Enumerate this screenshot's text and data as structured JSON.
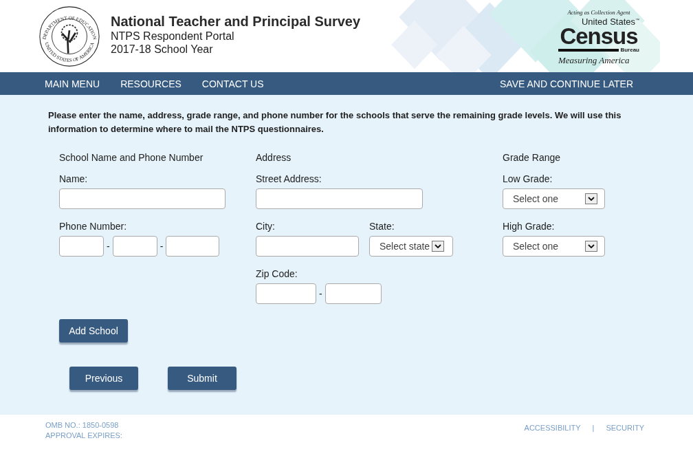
{
  "header": {
    "seal": {
      "top_text": "DEPARTMENT OF EDUCATION",
      "bottom_text": "UNITED STATES OF AMERICA"
    },
    "title": "National Teacher and Principal Survey",
    "subtitle": "NTPS Respondent Portal",
    "year": "2017-18 School Year",
    "census": {
      "tagline": "Acting as Collection Agent",
      "line1": "United States",
      "tm": "™",
      "name": "Census",
      "bureau": "Bureau",
      "motto": "Measuring America"
    }
  },
  "nav": {
    "items": [
      "MAIN MENU",
      "RESOURCES",
      "CONTACT US"
    ],
    "right": "SAVE AND CONTINUE LATER"
  },
  "instructions": "Please enter the name, address, grade range, and phone number for the schools that serve the remaining grade levels. We will use this information to determine where to mail the NTPS questionnaires.",
  "school": {
    "heading": "School Name and Phone Number",
    "name_label": "Name:",
    "phone_label": "Phone Number:",
    "phone_separators": [
      "-",
      "-"
    ]
  },
  "address": {
    "heading": "Address",
    "street_label": "Street Address:",
    "city_label": "City:",
    "state_label": "State:",
    "state_select": "Select state",
    "zip_label": "Zip Code:",
    "zip_separator": "-"
  },
  "grade": {
    "heading": "Grade Range",
    "low_label": "Low Grade:",
    "low_select": "Select one",
    "high_label": "High Grade:",
    "high_select": "Select one"
  },
  "add_button": "Add School",
  "buttons": [
    "Previous",
    "Submit"
  ],
  "footer": {
    "omb": "OMB NO.: 1850-0598",
    "expires": "APPROVAL EXPIRES:",
    "links": [
      "ACCESSIBILITY",
      "SECURITY"
    ],
    "separator": "|"
  }
}
